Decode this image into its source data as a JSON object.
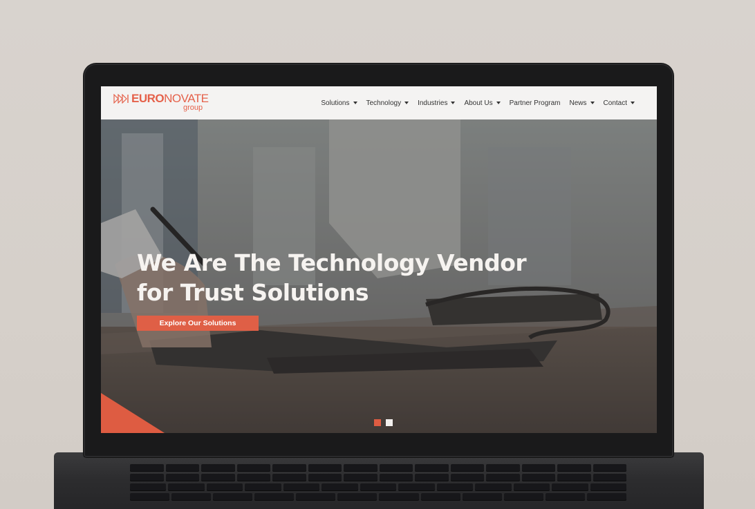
{
  "brand": {
    "name_bold": "EURO",
    "name_regular": "NOVATE",
    "subline": "group",
    "accent_color": "#e5614a"
  },
  "nav": {
    "items": [
      {
        "label": "Solutions",
        "has_dropdown": true
      },
      {
        "label": "Technology",
        "has_dropdown": true
      },
      {
        "label": "Industries",
        "has_dropdown": true
      },
      {
        "label": "About Us",
        "has_dropdown": true
      },
      {
        "label": "Partner Program",
        "has_dropdown": false
      },
      {
        "label": "News",
        "has_dropdown": true
      },
      {
        "label": "Contact",
        "has_dropdown": true
      }
    ]
  },
  "hero": {
    "title_line1": "We Are The Technology Vendor",
    "title_line2": "for Trust Solutions",
    "cta_label": "Explore Our Solutions",
    "cta_color": "#df5f46",
    "slides": {
      "count": 2,
      "active_index": 0
    }
  }
}
